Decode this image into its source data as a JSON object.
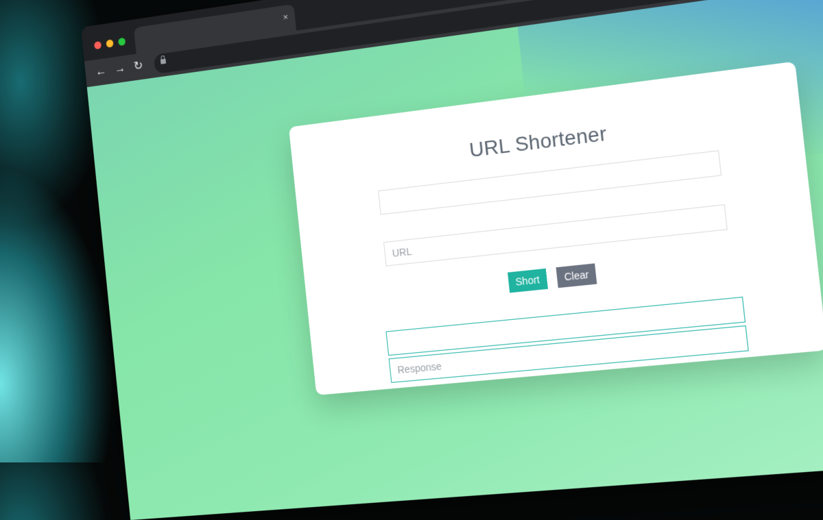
{
  "browser": {
    "tab": {
      "close_glyph": "×"
    },
    "nav": {
      "back_glyph": "←",
      "forward_glyph": "→",
      "reload_glyph": "↻"
    }
  },
  "page": {
    "title": "URL Shortener",
    "url_input": {
      "placeholder": "URL",
      "value": ""
    },
    "buttons": {
      "short_label": "Short",
      "clear_label": "Clear"
    },
    "response_input": {
      "placeholder": "Response",
      "value": ""
    }
  },
  "colors": {
    "accent": "#1fb3a0",
    "secondary": "#6b7280",
    "background_gradient_start": "#4a90e2",
    "background_gradient_end": "#86e5a8"
  }
}
